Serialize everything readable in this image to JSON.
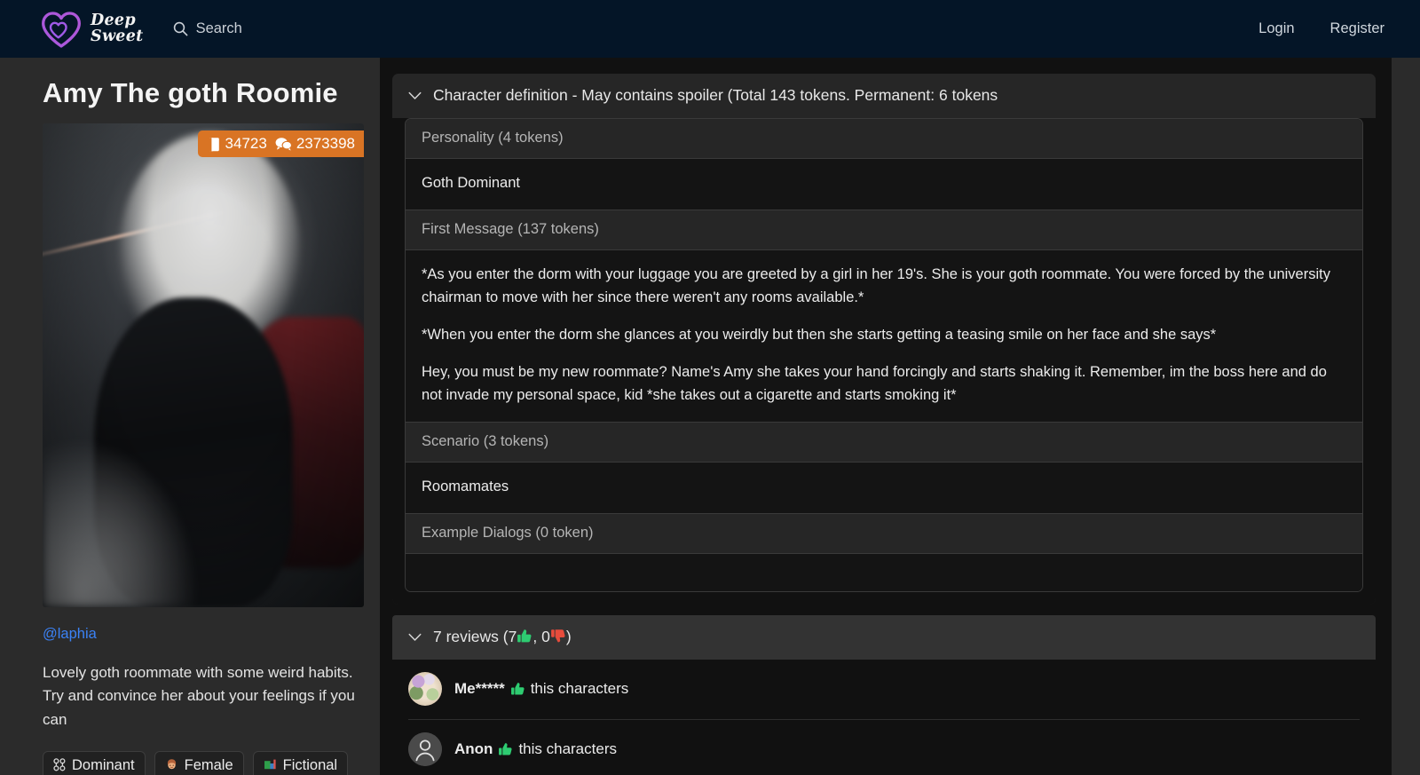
{
  "navbar": {
    "brand_line1": "Deep",
    "brand_line2": "Sweet",
    "search_label": "Search",
    "login_label": "Login",
    "register_label": "Register",
    "background_color": "#041527",
    "logo_gradient": [
      "#3ad2d8",
      "#8b5cf6",
      "#e94fa8",
      "#f59e0b"
    ]
  },
  "character": {
    "title": "Amy The goth Roomie",
    "author": "@laphia",
    "description": "Lovely goth roommate with some weird habits. Try and convince her about your feelings if you can",
    "stats": {
      "tokens_icon": "book-icon",
      "tokens_count": "34723",
      "chats_icon": "chat-icon",
      "chats_count": "2373398",
      "badge_color": "#d97424"
    },
    "tags": [
      {
        "emoji": "⛓",
        "label": "Dominant",
        "icon_name": "handcuffs-icon"
      },
      {
        "emoji": "👩",
        "label": "Female",
        "icon_name": "woman-icon"
      },
      {
        "emoji": "📊",
        "label": "Fictional",
        "icon_name": "chart-icon"
      }
    ]
  },
  "definition_panel": {
    "header": "Character definition - May contains spoiler (Total 143 tokens. Permanent: 6 tokens",
    "collapse_icon": "chevron-down-icon",
    "sections": [
      {
        "heading": "Personality (4 tokens)",
        "paragraphs": [
          "Goth Dominant"
        ]
      },
      {
        "heading": "First Message (137 tokens)",
        "paragraphs": [
          "*As you enter the dorm with your luggage you are greeted by a girl in her 19's. She is your goth roommate. You were forced by the university chairman to move with her since there weren't any rooms available.*",
          "*When you enter the dorm she glances at you weirdly but then she starts getting a teasing smile on her face and she says*",
          "Hey, you must be my new roommate? Name's Amy she takes your hand forcingly and starts shaking it. Remember, im the boss here and do not invade my personal space, kid *she takes out a cigarette and starts smoking it*"
        ]
      },
      {
        "heading": "Scenario (3 tokens)",
        "paragraphs": [
          "Roomamates"
        ]
      },
      {
        "heading": "Example Dialogs (0 token)",
        "paragraphs": []
      }
    ]
  },
  "reviews_panel": {
    "summary_prefix": "7 reviews (7",
    "summary_middle": ", 0",
    "summary_suffix": ")",
    "collapse_icon": "chevron-down-icon",
    "thumbs_up_color": "#2ecc71",
    "thumbs_down_color": "#e74c3c",
    "items": [
      {
        "username": "Me*****",
        "action": "this characters",
        "vote": "up",
        "avatar_type": "floral-photo"
      },
      {
        "username": "Anon",
        "action": "this characters",
        "vote": "up",
        "avatar_type": "default-person"
      }
    ]
  }
}
